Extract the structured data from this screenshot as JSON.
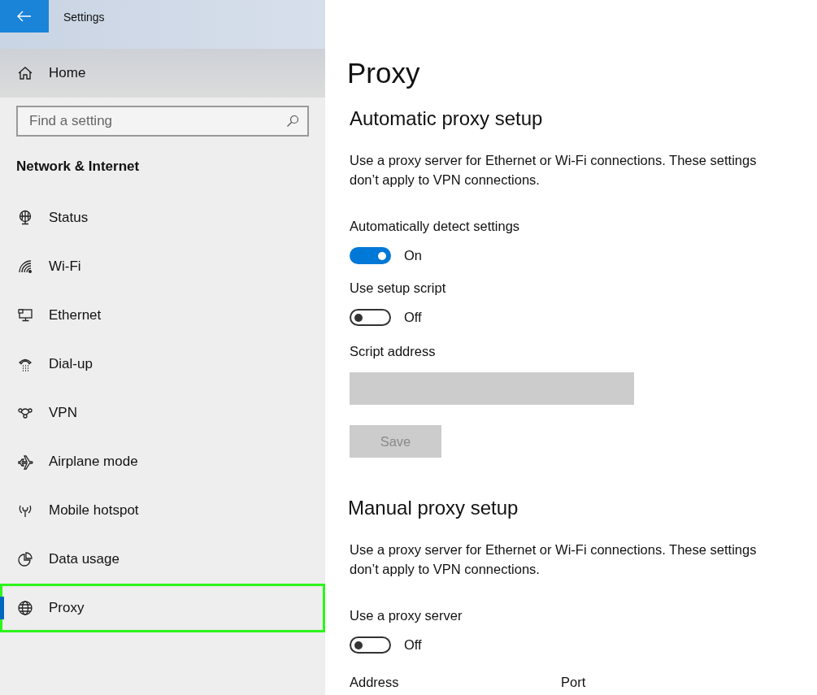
{
  "window": {
    "title": "Settings"
  },
  "sidebar": {
    "home": "Home",
    "search": {
      "placeholder": "Find a setting"
    },
    "section": "Network & Internet",
    "items": [
      {
        "label": "Status",
        "selected": false,
        "highlighted": false
      },
      {
        "label": "Wi-Fi",
        "selected": false,
        "highlighted": false
      },
      {
        "label": "Ethernet",
        "selected": false,
        "highlighted": false
      },
      {
        "label": "Dial-up",
        "selected": false,
        "highlighted": false
      },
      {
        "label": "VPN",
        "selected": false,
        "highlighted": false
      },
      {
        "label": "Airplane mode",
        "selected": false,
        "highlighted": false
      },
      {
        "label": "Mobile hotspot",
        "selected": false,
        "highlighted": false
      },
      {
        "label": "Data usage",
        "selected": false,
        "highlighted": false
      },
      {
        "label": "Proxy",
        "selected": true,
        "highlighted": true
      }
    ]
  },
  "page": {
    "title": "Proxy",
    "automatic": {
      "heading": "Automatic proxy setup",
      "description": "Use a proxy server for Ethernet or Wi-Fi connections. These settings don’t apply to VPN connections.",
      "toggles": [
        {
          "label": "Automatically detect settings",
          "on": true,
          "state": "On"
        },
        {
          "label": "Use setup script",
          "on": false,
          "state": "Off"
        }
      ],
      "script_address": {
        "label": "Script address",
        "disabled": true
      },
      "save": {
        "label": "Save",
        "disabled": true
      }
    },
    "manual": {
      "heading": "Manual proxy setup",
      "description": "Use a proxy server for Ethernet or Wi-Fi connections. These settings don’t apply to VPN connections.",
      "toggles": [
        {
          "label": "Use a proxy server",
          "on": false,
          "state": "Off"
        }
      ],
      "fields": [
        {
          "label": "Address"
        },
        {
          "label": "Port"
        }
      ]
    }
  }
}
